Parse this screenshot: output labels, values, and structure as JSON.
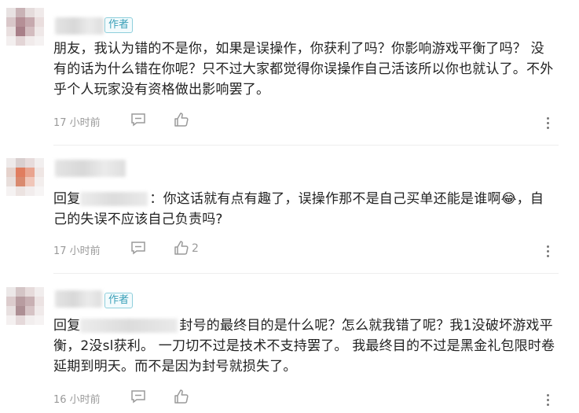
{
  "comments": [
    {
      "author_tag": "作者",
      "text": "朋友，我认为错的不是你，如果是误操作，你获利了吗？你影响游戏平衡了吗？ 没有的话为什么错在你呢？只不过大家都觉得你误操作自己活该所以你也就认了。不外乎个人玩家没有资格做出影响罢了。",
      "time": "17 小时前",
      "like_count": ""
    },
    {
      "author_tag": "",
      "reply_prefix": "回复",
      "text": "：你这话就有点有趣了，误操作那不是自己买单还能是谁啊😂，自己的失误不应该自己负责吗?",
      "time": "17 小时前",
      "like_count": "2"
    },
    {
      "author_tag": "作者",
      "reply_prefix": "回复",
      "text": "封号的最终目的是什么呢？怎么就我错了呢？我1没破坏游戏平衡，2没sl获利。 一刀切不过是技术不支持罢了。 我最终目的不过是黑金礼包限时卷延期到明天。而不是因为封号就损失了。",
      "time": "16 小时前",
      "like_count": ""
    }
  ],
  "icons": {
    "reply": "comment-bubble-icon",
    "like": "thumbs-up-icon",
    "more": "more-vertical-icon"
  },
  "colors": {
    "author_tag": "#3aa0b8",
    "meta_text": "#9a9a9a"
  }
}
